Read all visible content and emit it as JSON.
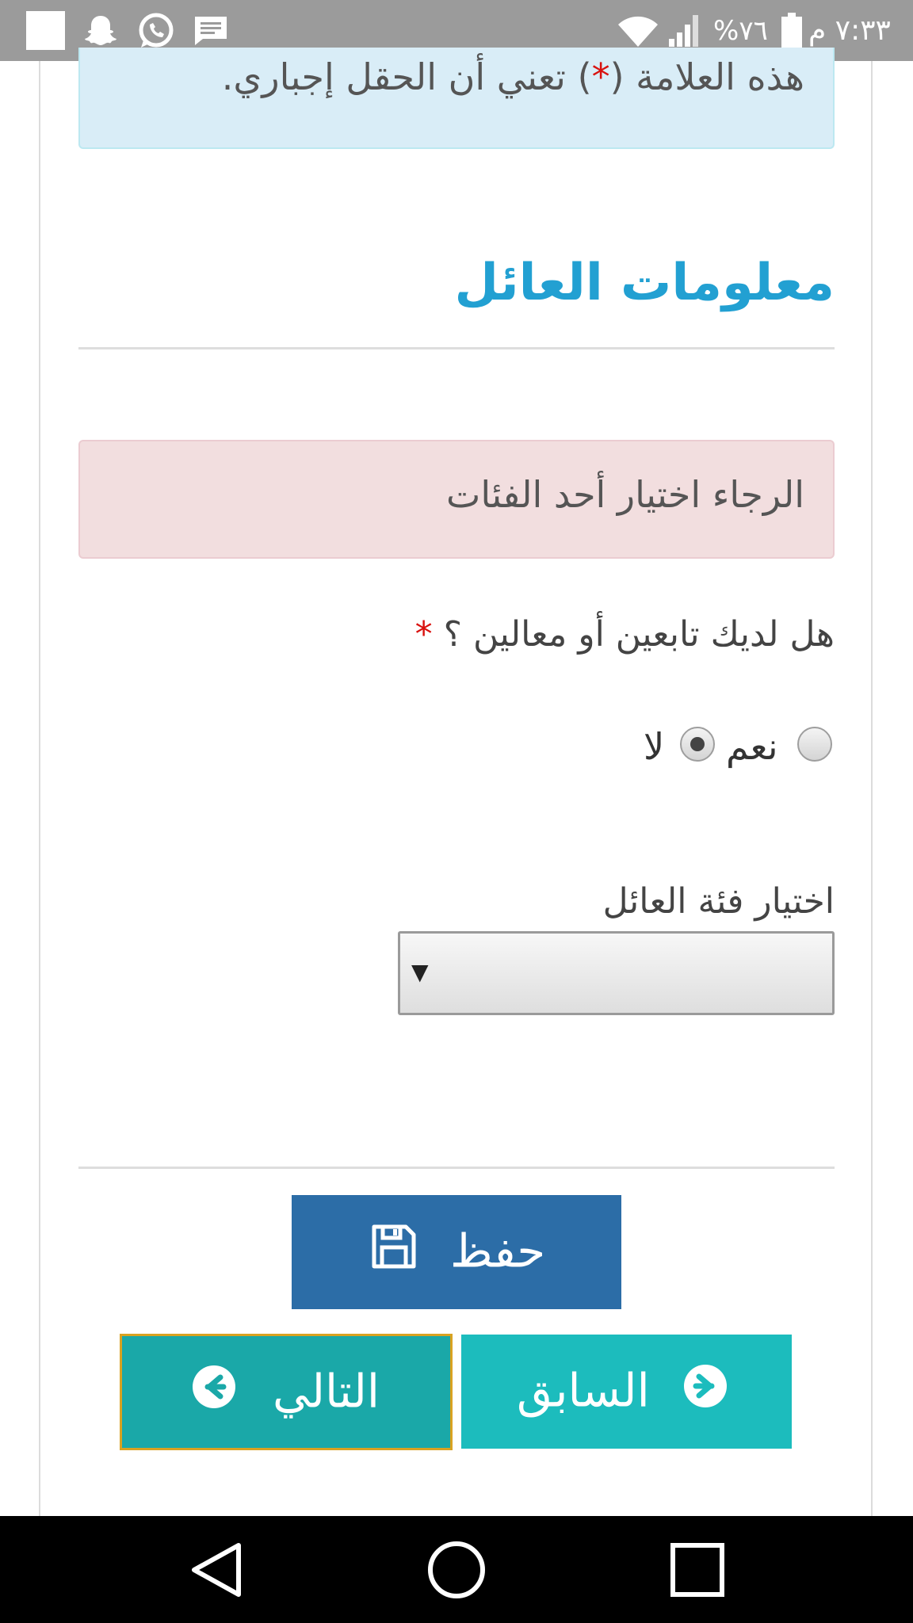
{
  "status_bar": {
    "time": "٧:٣٣ م",
    "battery_percent": "%٧٦",
    "icons": [
      "app-square-icon",
      "ghost-icon",
      "whatsapp-icon",
      "message-icon",
      "wifi-icon",
      "signal-icon",
      "battery-icon"
    ]
  },
  "info_alert": {
    "text_before": "هذه العلامة (",
    "star": "*",
    "text_after": ") تعني أن الحقل إجباري."
  },
  "section": {
    "title": "معلومات العائل"
  },
  "error_alert": {
    "text": "الرجاء اختيار أحد الفئات"
  },
  "question": {
    "text": "هل لديك تابعين أو معالين ؟",
    "star": "*"
  },
  "radio_options": [
    {
      "label": "نعم",
      "checked": false
    },
    {
      "label": "لا",
      "checked": true
    }
  ],
  "select": {
    "label": "اختيار فئة العائل",
    "value": ""
  },
  "buttons": {
    "save": "حفظ",
    "next": "التالي",
    "previous": "السابق"
  },
  "colors": {
    "accent_title": "#22a0d2",
    "save_button": "#2c6da7",
    "next_button": "#1aa8a8",
    "prev_button": "#1cbcbd",
    "focus_border": "#d9a221",
    "info_bg": "#d9edf7",
    "error_bg": "#f2dedf"
  },
  "nav_bar": {
    "icons": [
      "back-icon",
      "home-icon",
      "recents-icon"
    ]
  }
}
